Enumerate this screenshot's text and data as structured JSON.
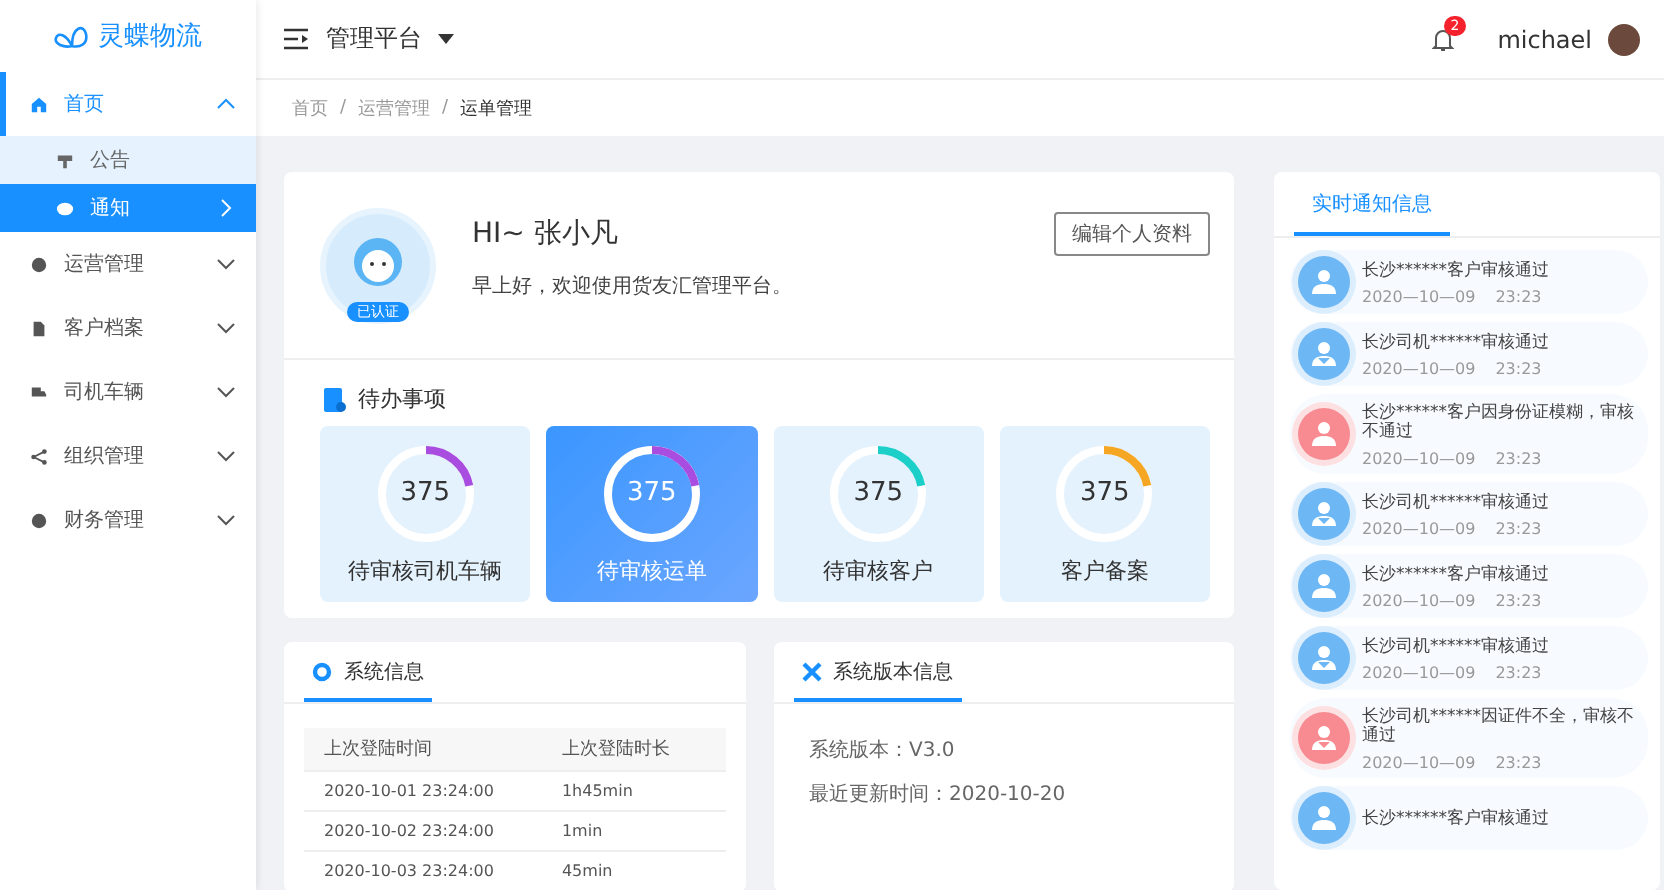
{
  "sidebar": {
    "logo": "灵蝶物流",
    "items": [
      {
        "label": "首页",
        "selected": true,
        "expanded": true,
        "children": [
          {
            "label": "公告",
            "selected": false
          },
          {
            "label": "通知",
            "selected": true
          }
        ]
      },
      {
        "label": "运营管理",
        "selected": false,
        "expanded": false
      },
      {
        "label": "客户档案",
        "selected": false,
        "expanded": false
      },
      {
        "label": "司机车辆",
        "selected": false,
        "expanded": false
      },
      {
        "label": "组织管理",
        "selected": false,
        "expanded": false
      },
      {
        "label": "财务管理",
        "selected": false,
        "expanded": false
      }
    ]
  },
  "header": {
    "title": "管理平台",
    "badge": "2",
    "user": "michael"
  },
  "breadcrumb": {
    "separator": "/",
    "items": [
      "首页",
      "运营管理",
      "运单管理"
    ]
  },
  "profile": {
    "greeting": "HI~ 张小凡",
    "welcome": "早上好，欢迎使用货友汇管理平台。",
    "verified": "已认证",
    "edit_button": "编辑个人资料"
  },
  "todo": {
    "title": "待办事项",
    "items": [
      {
        "count": "375",
        "label": "待审核司机车辆",
        "level": 0.22,
        "color": "#a94ce0",
        "selected": false
      },
      {
        "count": "375",
        "label": "待审核运单",
        "level": 0.22,
        "color": "#a94ce0",
        "selected": true
      },
      {
        "count": "375",
        "label": "待审核客户",
        "level": 0.22,
        "color": "#1ccfc9",
        "selected": false
      },
      {
        "count": "375",
        "label": "客户备案",
        "level": 0.22,
        "color": "#f5a623",
        "selected": false
      }
    ]
  },
  "system_info": {
    "title": "系统信息",
    "columns": [
      "上次登陆时间",
      "上次登陆时长"
    ],
    "rows": [
      [
        "2020-10-01  23:24:00",
        "1h45min"
      ],
      [
        "2020-10-02  23:24:00",
        "1min"
      ],
      [
        "2020-10-03  23:24:00",
        "45min"
      ]
    ]
  },
  "version_info": {
    "title": "系统版本信息",
    "lines": [
      "系统版本：V3.0",
      "最近更新时间：2020-10-20"
    ]
  },
  "notifications": {
    "title": "实时通知信息",
    "items": [
      {
        "kind": "customer",
        "rejected": false,
        "text": "长沙******客户审核通过",
        "date": "2020—10—09",
        "time": "23:23"
      },
      {
        "kind": "driver",
        "rejected": false,
        "text": "长沙司机******审核通过",
        "date": "2020—10—09",
        "time": "23:23"
      },
      {
        "kind": "customer",
        "rejected": true,
        "text": "长沙******客户因身份证模糊，审核不通过",
        "date": "2020—10—09",
        "time": "23:23"
      },
      {
        "kind": "driver",
        "rejected": false,
        "text": "长沙司机******审核通过",
        "date": "2020—10—09",
        "time": "23:23"
      },
      {
        "kind": "customer",
        "rejected": false,
        "text": "长沙******客户审核通过",
        "date": "2020—10—09",
        "time": "23:23"
      },
      {
        "kind": "driver",
        "rejected": false,
        "text": "长沙司机******审核通过",
        "date": "2020—10—09",
        "time": "23:23"
      },
      {
        "kind": "driver",
        "rejected": true,
        "text": "长沙司机******因证件不全，审核不通过",
        "date": "2020—10—09",
        "time": "23:23"
      },
      {
        "kind": "customer",
        "rejected": false,
        "text": "长沙******客户审核通过"
      }
    ]
  }
}
